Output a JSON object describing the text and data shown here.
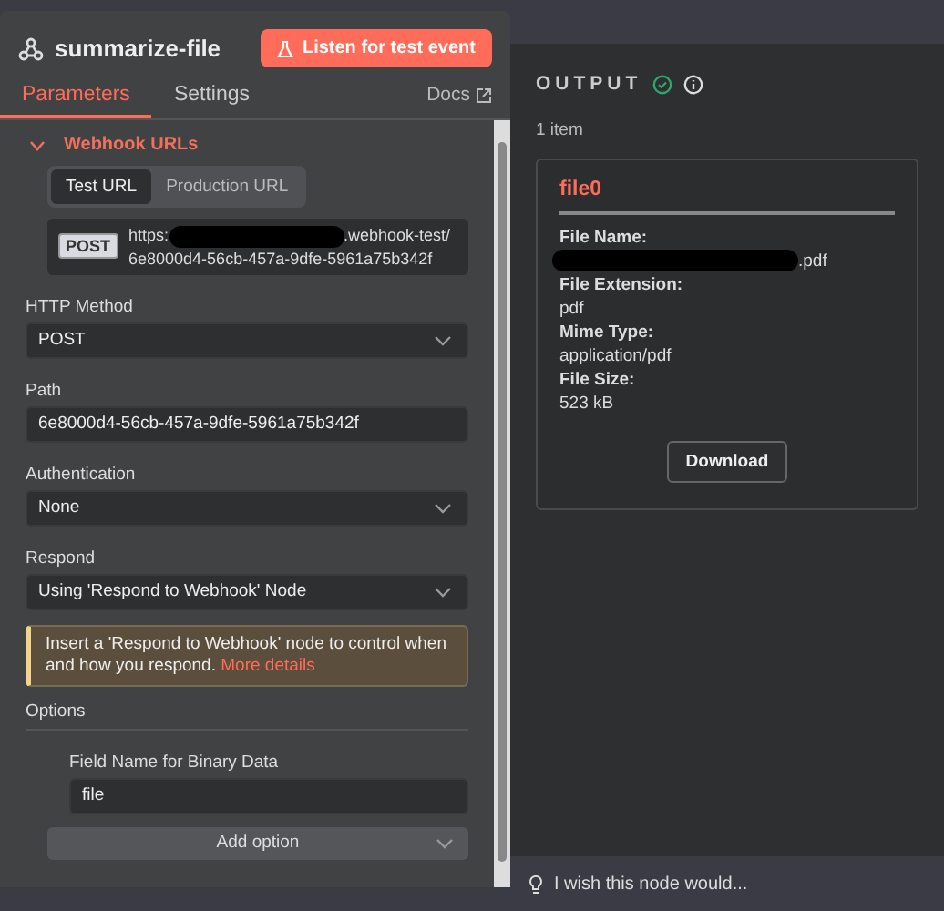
{
  "node": {
    "title": "summarize-file",
    "listen_button": "Listen for test event"
  },
  "tabs": [
    {
      "label": "Parameters",
      "selected": true
    },
    {
      "label": "Settings",
      "selected": false
    }
  ],
  "docs_link": "Docs",
  "webhook_urls": {
    "title": "Webhook URLs",
    "expanded": true,
    "url_tabs": [
      {
        "label": "Test URL",
        "selected": true
      },
      {
        "label": "Production URL",
        "selected": false
      }
    ],
    "method_badge": "POST",
    "url_start": "https:",
    "redacted": true,
    "url_end": ".webhook-test/6e8000d4-56cb-457a-9dfe-5961a75b342f"
  },
  "fields": [
    {
      "kind": "select",
      "label": "HTTP Method",
      "value": "POST"
    },
    {
      "kind": "text",
      "label": "Path",
      "value": "6e8000d4-56cb-457a-9dfe-5961a75b342f"
    },
    {
      "kind": "select",
      "label": "Authentication",
      "value": "None"
    },
    {
      "kind": "select",
      "label": "Respond",
      "value": "Using 'Respond to Webhook' Node"
    }
  ],
  "notice": {
    "text": "Insert a 'Respond to Webhook' node to control when and how you respond.",
    "link": "More details"
  },
  "options": {
    "title": "Options",
    "items": [
      {
        "label": "Field Name for Binary Data",
        "value": "file"
      }
    ],
    "add_button": "Add option"
  },
  "output": {
    "title": "OUTPUT",
    "count": "1 item",
    "card": {
      "title": "file0",
      "fields": [
        {
          "label": "File Name:",
          "value": ".pdf",
          "redacted": true
        },
        {
          "label": "File Extension:",
          "value": "pdf"
        },
        {
          "label": "Mime Type:",
          "value": "application/pdf"
        },
        {
          "label": "File Size:",
          "value": "523 kB"
        }
      ],
      "download": "Download"
    }
  },
  "feedback": {
    "placeholder": "I wish this node would..."
  }
}
